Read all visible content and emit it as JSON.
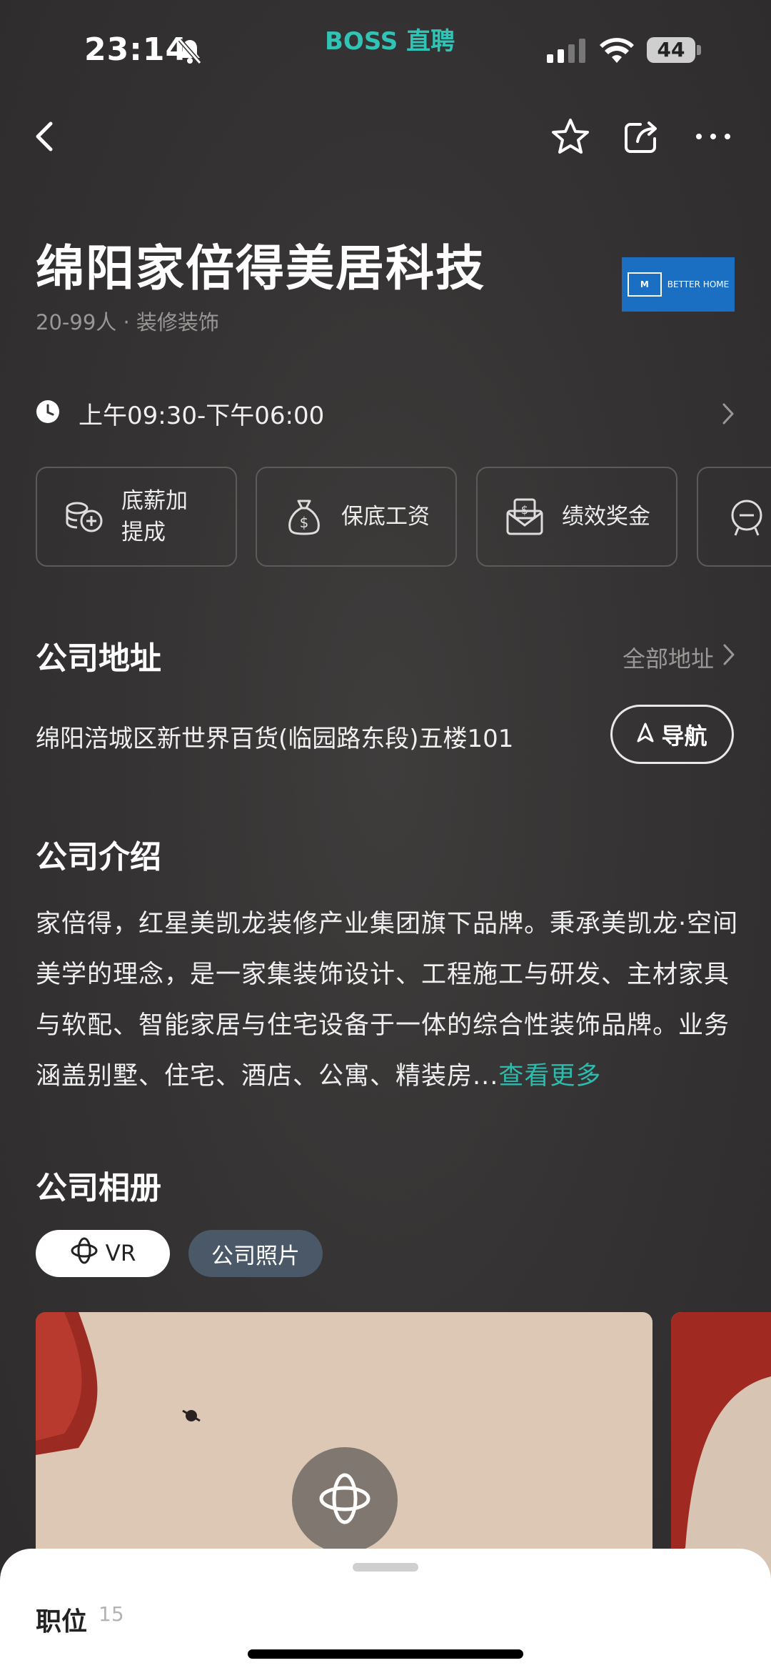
{
  "status_bar": {
    "time": "23:14",
    "brand": "BOSS 直聘",
    "battery": "44",
    "icons": [
      "bell-muted-icon",
      "signal-icon",
      "wifi-icon",
      "battery-icon"
    ]
  },
  "nav": {
    "icons": [
      "back-icon",
      "star-icon",
      "share-icon",
      "more-icon"
    ]
  },
  "company": {
    "name": "绵阳家倍得美居科技",
    "meta": "20-99人 · 装修装饰",
    "logo_text_left": "M",
    "logo_text_right": "BETTER HOME"
  },
  "hours": {
    "text": "上午09:30-下午06:00"
  },
  "benefits": [
    {
      "label": "底薪加\n提成",
      "icon": "coins-plus-icon"
    },
    {
      "label": "保底工资",
      "icon": "money-bag-icon"
    },
    {
      "label": "绩效奖金",
      "icon": "envelope-dollar-icon"
    }
  ],
  "address_section": {
    "title": "公司地址",
    "all_label": "全部地址",
    "address": "绵阳涪城区新世界百货(临园路东段)五楼101",
    "nav_button": "导航"
  },
  "intro_section": {
    "title": "公司介绍",
    "text": "家倍得，红星美凯龙装修产业集团旗下品牌。秉承美凯龙·空间美学的理念，是一家集装饰设计、工程施工与研发、主材家具与软配、智能家居与住宅设备于一体的综合性装饰品牌。业务涵盖别墅、住宅、酒店、公寓、精装房...",
    "more": "查看更多"
  },
  "album_section": {
    "title": "公司相册",
    "chips": [
      "VR",
      "公司照片"
    ]
  },
  "bottom_sheet": {
    "jobs_label": "职位",
    "jobs_count": "15"
  },
  "colors": {
    "accent": "#2cbcae",
    "logo_bg": "#1a6fc2",
    "chip_active_bg": "#4a5868"
  }
}
